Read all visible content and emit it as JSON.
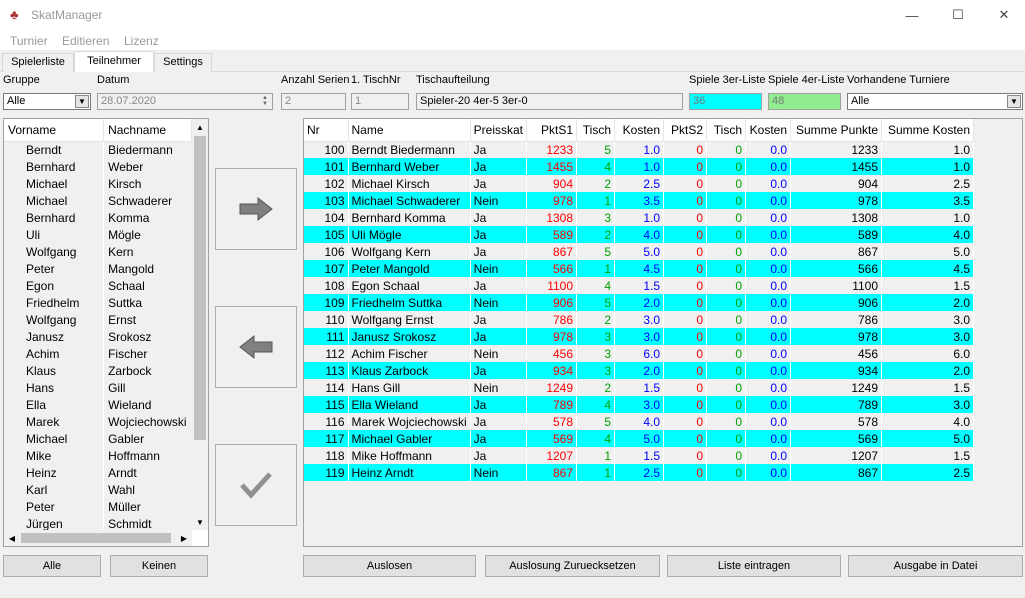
{
  "window": {
    "title": "SkatManager",
    "minimize": "—",
    "maximize": "☐",
    "close": "✕"
  },
  "menu": [
    "Turnier",
    "Editieren",
    "Lizenz"
  ],
  "tabs": [
    "Spielerliste",
    "Teilnehmer",
    "Settings"
  ],
  "form": {
    "gruppe_label": "Gruppe",
    "gruppe_value": "Alle",
    "datum_label": "Datum",
    "datum_value": "28.07.2020",
    "anzahl_label": "Anzahl Serien",
    "anzahl_value": "2",
    "tischnr_label": "1. TischNr",
    "tischnr_value": "1",
    "tischauf_label": "Tischaufteilung",
    "tischauf_value": "Spieler-20 4er-5 3er-0",
    "spiele3_label": "Spiele 3er-Liste",
    "spiele3_value": "36",
    "spiele4_label": "Spiele 4er-Liste",
    "spiele4_value": "48",
    "turniere_label": "Vorhandene Turniere",
    "turniere_value": "Alle"
  },
  "colors": {
    "cyan": "#00ffff",
    "green_field": "#90ee90",
    "red": "#ff0000",
    "green": "#00a000",
    "blue": "#0000ff"
  },
  "left_table": {
    "headers": [
      "Vorname",
      "Nachname"
    ],
    "rows": [
      [
        "Berndt",
        "Biedermann"
      ],
      [
        "Bernhard",
        "Weber"
      ],
      [
        "Michael",
        "Kirsch"
      ],
      [
        "Michael",
        "Schwaderer"
      ],
      [
        "Bernhard",
        "Komma"
      ],
      [
        "Uli",
        "Mögle"
      ],
      [
        "Wolfgang",
        "Kern"
      ],
      [
        "Peter",
        "Mangold"
      ],
      [
        "Egon",
        "Schaal"
      ],
      [
        "Friedhelm",
        "Suttka"
      ],
      [
        "Wolfgang",
        "Ernst"
      ],
      [
        "Janusz",
        "Srokosz"
      ],
      [
        "Achim",
        "Fischer"
      ],
      [
        "Klaus",
        "Zarbock"
      ],
      [
        "Hans",
        "Gill"
      ],
      [
        "Ella",
        "Wieland"
      ],
      [
        "Marek",
        "Wojciechowski"
      ],
      [
        "Michael",
        "Gabler"
      ],
      [
        "Mike",
        "Hoffmann"
      ],
      [
        "Heinz",
        "Arndt"
      ],
      [
        "Karl",
        "Wahl"
      ],
      [
        "Peter",
        "Müller"
      ],
      [
        "Jürgen",
        "Schmidt"
      ]
    ]
  },
  "right_table": {
    "headers": [
      "Nr",
      "Name",
      "Preisskat",
      "PktS1",
      "Tisch",
      "Kosten",
      "PktS2",
      "Tisch",
      "Kosten",
      "Summe Punkte",
      "Summe Kosten"
    ],
    "rows": [
      [
        "100",
        "Berndt Biedermann",
        "Ja",
        "1233",
        "5",
        "1.0",
        "0",
        "0",
        "0.0",
        "1233",
        "1.0"
      ],
      [
        "101",
        "Bernhard Weber",
        "Ja",
        "1455",
        "4",
        "1.0",
        "0",
        "0",
        "0.0",
        "1455",
        "1.0"
      ],
      [
        "102",
        "Michael Kirsch",
        "Ja",
        "904",
        "2",
        "2.5",
        "0",
        "0",
        "0.0",
        "904",
        "2.5"
      ],
      [
        "103",
        "Michael Schwaderer",
        "Nein",
        "978",
        "1",
        "3.5",
        "0",
        "0",
        "0.0",
        "978",
        "3.5"
      ],
      [
        "104",
        "Bernhard Komma",
        "Ja",
        "1308",
        "3",
        "1.0",
        "0",
        "0",
        "0.0",
        "1308",
        "1.0"
      ],
      [
        "105",
        "Uli Mögle",
        "Ja",
        "589",
        "2",
        "4.0",
        "0",
        "0",
        "0.0",
        "589",
        "4.0"
      ],
      [
        "106",
        "Wolfgang Kern",
        "Ja",
        "867",
        "5",
        "5.0",
        "0",
        "0",
        "0.0",
        "867",
        "5.0"
      ],
      [
        "107",
        "Peter Mangold",
        "Nein",
        "566",
        "1",
        "4.5",
        "0",
        "0",
        "0.0",
        "566",
        "4.5"
      ],
      [
        "108",
        "Egon Schaal",
        "Ja",
        "1100",
        "4",
        "1.5",
        "0",
        "0",
        "0.0",
        "1100",
        "1.5"
      ],
      [
        "109",
        "Friedhelm Suttka",
        "Nein",
        "906",
        "5",
        "2.0",
        "0",
        "0",
        "0.0",
        "906",
        "2.0"
      ],
      [
        "110",
        "Wolfgang Ernst",
        "Ja",
        "786",
        "2",
        "3.0",
        "0",
        "0",
        "0.0",
        "786",
        "3.0"
      ],
      [
        "111",
        "Janusz Srokosz",
        "Ja",
        "978",
        "3",
        "3.0",
        "0",
        "0",
        "0.0",
        "978",
        "3.0"
      ],
      [
        "112",
        "Achim Fischer",
        "Nein",
        "456",
        "3",
        "6.0",
        "0",
        "0",
        "0.0",
        "456",
        "6.0"
      ],
      [
        "113",
        "Klaus Zarbock",
        "Ja",
        "934",
        "3",
        "2.0",
        "0",
        "0",
        "0.0",
        "934",
        "2.0"
      ],
      [
        "114",
        "Hans Gill",
        "Nein",
        "1249",
        "2",
        "1.5",
        "0",
        "0",
        "0.0",
        "1249",
        "1.5"
      ],
      [
        "115",
        "Ella Wieland",
        "Ja",
        "789",
        "4",
        "3.0",
        "0",
        "0",
        "0.0",
        "789",
        "3.0"
      ],
      [
        "116",
        "Marek Wojciechowski",
        "Ja",
        "578",
        "5",
        "4.0",
        "0",
        "0",
        "0.0",
        "578",
        "4.0"
      ],
      [
        "117",
        "Michael Gabler",
        "Ja",
        "569",
        "4",
        "5.0",
        "0",
        "0",
        "0.0",
        "569",
        "5.0"
      ],
      [
        "118",
        "Mike Hoffmann",
        "Ja",
        "1207",
        "1",
        "1.5",
        "0",
        "0",
        "0.0",
        "1207",
        "1.5"
      ],
      [
        "119",
        "Heinz Arndt",
        "Nein",
        "867",
        "1",
        "2.5",
        "0",
        "0",
        "0.0",
        "867",
        "2.5"
      ]
    ]
  },
  "icons": {
    "add": "arrow-right-icon",
    "remove": "arrow-left-icon",
    "confirm": "checkmark-icon"
  },
  "buttons": {
    "alle": "Alle",
    "keinen": "Keinen",
    "auslosen": "Auslosen",
    "zuruecksetzen": "Auslosung Zuruecksetzen",
    "eintragen": "Liste eintragen",
    "ausgabe": "Ausgabe in Datei"
  }
}
